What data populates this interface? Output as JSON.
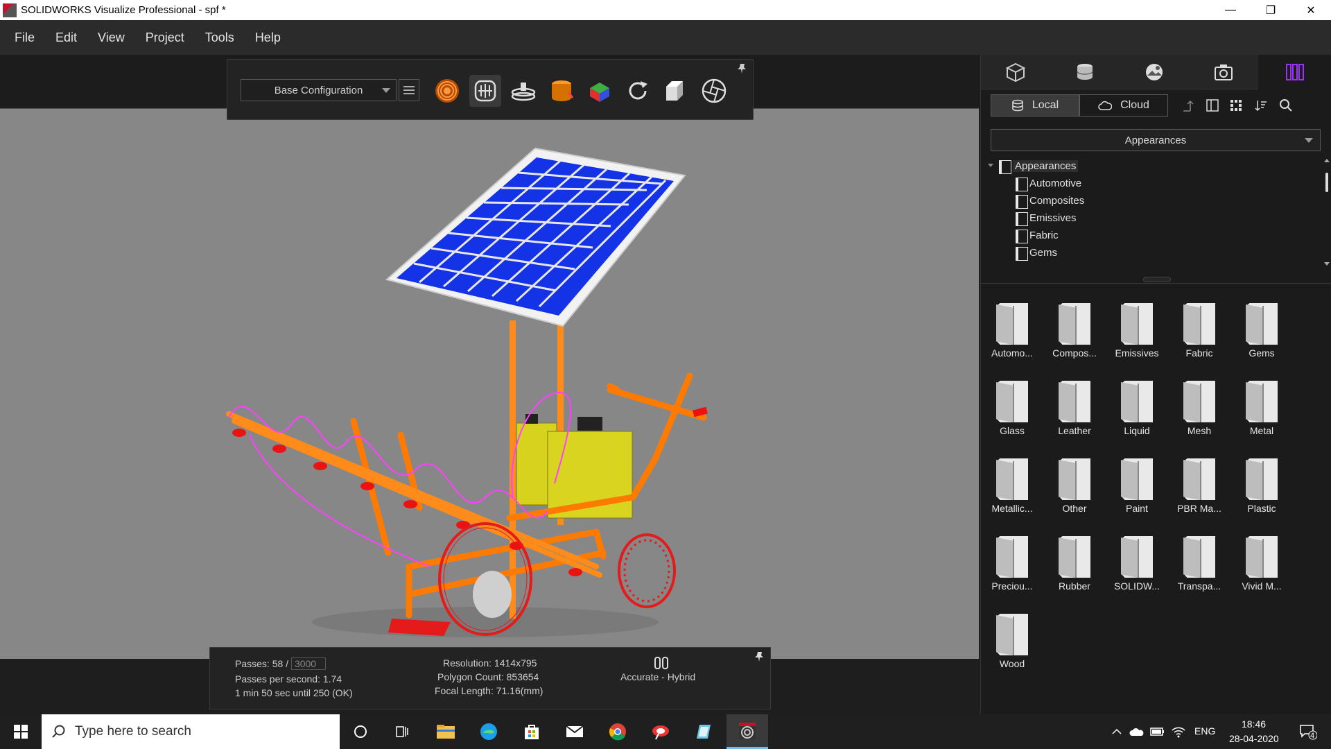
{
  "window": {
    "title": "SOLIDWORKS Visualize Professional - spf *",
    "minimize": "—",
    "maximize": "❐",
    "close": "✕"
  },
  "menu": [
    "File",
    "Edit",
    "View",
    "Project",
    "Tools",
    "Help"
  ],
  "toolbar": {
    "configuration": "Base Configuration",
    "tools": [
      "render-mode-icon",
      "select-mode-icon",
      "turntable-icon",
      "appearance-bucket-icon",
      "transform-axes-icon",
      "reset-rotate-icon",
      "camera-box-icon",
      "aperture-icon"
    ]
  },
  "status": {
    "passes_label": "Passes: 58 /",
    "passes_target": "3000",
    "passes_per_second": "Passes per second: 1.74",
    "time_remaining": "1 min 50 sec until 250 (OK)",
    "resolution": "Resolution: 1414x795",
    "polygon_count": "Polygon Count: 853654",
    "focal_length": "Focal Length: 71.16(mm)",
    "render_mode": "Accurate - Hybrid"
  },
  "panel": {
    "tabs": [
      "models-tab",
      "appearances-tab",
      "environments-tab",
      "cameras-tab",
      "libraries-tab"
    ],
    "source_local": "Local",
    "source_cloud": "Cloud",
    "library_select": "Appearances",
    "tree": {
      "root": "Appearances",
      "children": [
        "Automotive",
        "Composites",
        "Emissives",
        "Fabric",
        "Gems"
      ]
    },
    "tiles": [
      "Automo...",
      "Compos...",
      "Emissives",
      "Fabric",
      "Gems",
      "Glass",
      "Leather",
      "Liquid",
      "Mesh",
      "Metal",
      "Metallic...",
      "Other",
      "Paint",
      "PBR Ma...",
      "Plastic",
      "Preciou...",
      "Rubber",
      "SOLIDW...",
      "Transpa...",
      "Vivid M...",
      "Wood"
    ]
  },
  "taskbar": {
    "search_placeholder": "Type here to search",
    "language": "ENG",
    "time": "18:46",
    "date": "28-04-2020",
    "notification_count": "4"
  },
  "colors": {
    "accent": "#9b30ff",
    "viewport_bg": "#878787",
    "frame_orange": "#ff7a00",
    "panel_blue": "#1f3cff"
  }
}
